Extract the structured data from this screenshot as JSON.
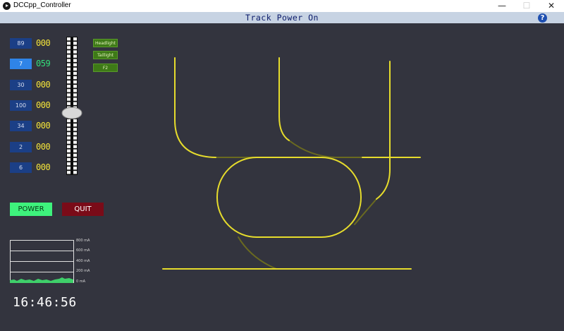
{
  "window": {
    "title": "DCCpp_Controller",
    "minimize_glyph": "—",
    "maximize_glyph": "☐",
    "close_glyph": "✕"
  },
  "header": {
    "status": "Track Power On",
    "help_glyph": "?"
  },
  "cabs": [
    {
      "id": "89",
      "speed": "000",
      "active": false
    },
    {
      "id": "7",
      "speed": "059",
      "active": true
    },
    {
      "id": "30",
      "speed": "000",
      "active": false
    },
    {
      "id": "100",
      "speed": "000",
      "active": false
    },
    {
      "id": "34",
      "speed": "000",
      "active": false
    },
    {
      "id": "2",
      "speed": "000",
      "active": false
    },
    {
      "id": "6",
      "speed": "000",
      "active": false
    }
  ],
  "functions": [
    "Headlight",
    "Taillight",
    "F2"
  ],
  "throttle": {
    "level": 0.59
  },
  "buttons": {
    "power": "POWER",
    "quit": "QUIT"
  },
  "current_meter": {
    "labels": [
      "800 mA",
      "600 mA",
      "400 mA",
      "200 mA",
      "0 mA"
    ]
  },
  "clock": "16:46:56",
  "colors": {
    "track_active": "#e6dc2c",
    "track_inactive": "#6a6a20",
    "panel_bg": "#33343e",
    "header_bg": "#c7d3e3"
  }
}
